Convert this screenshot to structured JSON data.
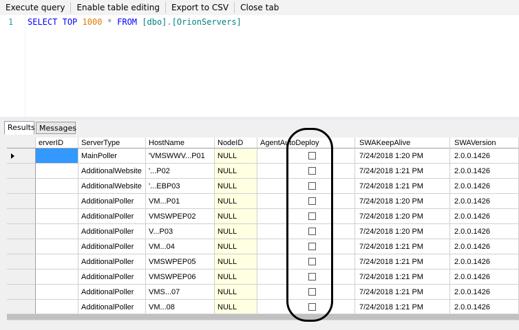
{
  "toolbar": {
    "items": [
      "Execute query",
      "Enable table editing",
      "Export to CSV",
      "Close tab"
    ]
  },
  "editor": {
    "line_number": "1",
    "tokens": {
      "select": "SELECT",
      "top": "TOP",
      "limit": "1000",
      "star": "*",
      "from": "FROM",
      "schema": "[dbo]",
      "dot": ".",
      "table": "[OrionServers]"
    }
  },
  "result_tabs": {
    "results": "Results",
    "messages": "Messages"
  },
  "grid": {
    "columns": [
      "erverID",
      "ServerType",
      "HostName",
      "NodeID",
      "AgentAutoDeploy",
      "SWAKeepAlive",
      "SWAVersion"
    ],
    "rows": [
      {
        "server_id": "",
        "server_type": "MainPoller",
        "host_name": "'VMSWWV...P01",
        "node_id": "NULL",
        "keep_alive": "7/24/2018 1:20 PM",
        "version": "2.0.0.1426"
      },
      {
        "server_id": "",
        "server_type": "AdditionalWebsite",
        "host_name": "'...P02",
        "node_id": "NULL",
        "keep_alive": "7/24/2018 1:21 PM",
        "version": "2.0.0.1426"
      },
      {
        "server_id": "",
        "server_type": "AdditionalWebsite",
        "host_name": "'...EBP03",
        "node_id": "NULL",
        "keep_alive": "7/24/2018 1:21 PM",
        "version": "2.0.0.1426"
      },
      {
        "server_id": "",
        "server_type": "AdditionalPoller",
        "host_name": "VM...P01",
        "node_id": "NULL",
        "keep_alive": "7/24/2018 1:20 PM",
        "version": "2.0.0.1426"
      },
      {
        "server_id": "",
        "server_type": "AdditionalPoller",
        "host_name": "VMSWPEP02",
        "node_id": "NULL",
        "keep_alive": "7/24/2018 1:20 PM",
        "version": "2.0.0.1426"
      },
      {
        "server_id": "",
        "server_type": "AdditionalPoller",
        "host_name": "V...P03",
        "node_id": "NULL",
        "keep_alive": "7/24/2018 1:20 PM",
        "version": "2.0.0.1426"
      },
      {
        "server_id": "",
        "server_type": "AdditionalPoller",
        "host_name": "VM...04",
        "node_id": "NULL",
        "keep_alive": "7/24/2018 1:21 PM",
        "version": "2.0.0.1426"
      },
      {
        "server_id": "",
        "server_type": "AdditionalPoller",
        "host_name": "VMSWPEP05",
        "node_id": "NULL",
        "keep_alive": "7/24/2018 1:21 PM",
        "version": "2.0.0.1426"
      },
      {
        "server_id": "",
        "server_type": "AdditionalPoller",
        "host_name": "VMSWPEP06",
        "node_id": "NULL",
        "keep_alive": "7/24/2018 1:21 PM",
        "version": "2.0.0.1426"
      },
      {
        "server_id": "",
        "server_type": "AdditionalPoller",
        "host_name": "VMS...07",
        "node_id": "NULL",
        "keep_alive": "7/24/2018 1:21 PM",
        "version": "2.0.0.1426"
      },
      {
        "server_id": "",
        "server_type": "AdditionalPoller",
        "host_name": "VM...08",
        "node_id": "NULL",
        "keep_alive": "7/24/2018 1:21 PM",
        "version": "2.0.0.1426"
      }
    ],
    "agent_auto_deploy": [
      false,
      false,
      false,
      false,
      false,
      false,
      false,
      false,
      false,
      false,
      false
    ],
    "selected_row": 0
  },
  "colors": {
    "null_cell": "#ffffe1",
    "selected_cell": "#3399ff",
    "keyword": "#0000ff",
    "identifier": "#008080",
    "number": "#e07b00"
  }
}
